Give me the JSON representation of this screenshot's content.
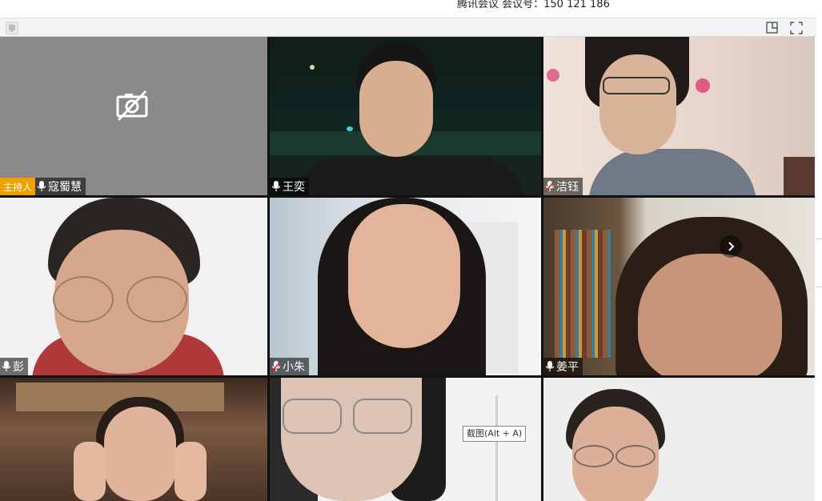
{
  "window": {
    "title": "腾讯会议 会议号：150 121 186"
  },
  "toolbar": {
    "shield_icon": "shield-icon",
    "layout_icon": "layout-icon",
    "fullscreen_icon": "fullscreen-icon"
  },
  "participants": [
    {
      "name": "寇蜀慧",
      "host_badge": "主持人",
      "camera": "off",
      "mic": "on"
    },
    {
      "name": "王奕",
      "camera": "on",
      "mic": "on"
    },
    {
      "name": "洁钰",
      "camera": "on",
      "mic": "muted"
    },
    {
      "name": "彭",
      "camera": "on",
      "mic": "on"
    },
    {
      "name": "小朱",
      "camera": "on",
      "mic": "muted"
    },
    {
      "name": "姜平",
      "camera": "on",
      "mic": "on"
    },
    {
      "name": "",
      "camera": "on",
      "mic": ""
    },
    {
      "name": "",
      "camera": "on",
      "mic": ""
    },
    {
      "name": "",
      "camera": "on",
      "mic": ""
    }
  ],
  "tooltip": {
    "text": "截图(Alt + A)"
  },
  "colors": {
    "host_badge": "#f0a000",
    "camera_off_bg": "#8a8a8a",
    "muted_mic": "#e02020"
  }
}
